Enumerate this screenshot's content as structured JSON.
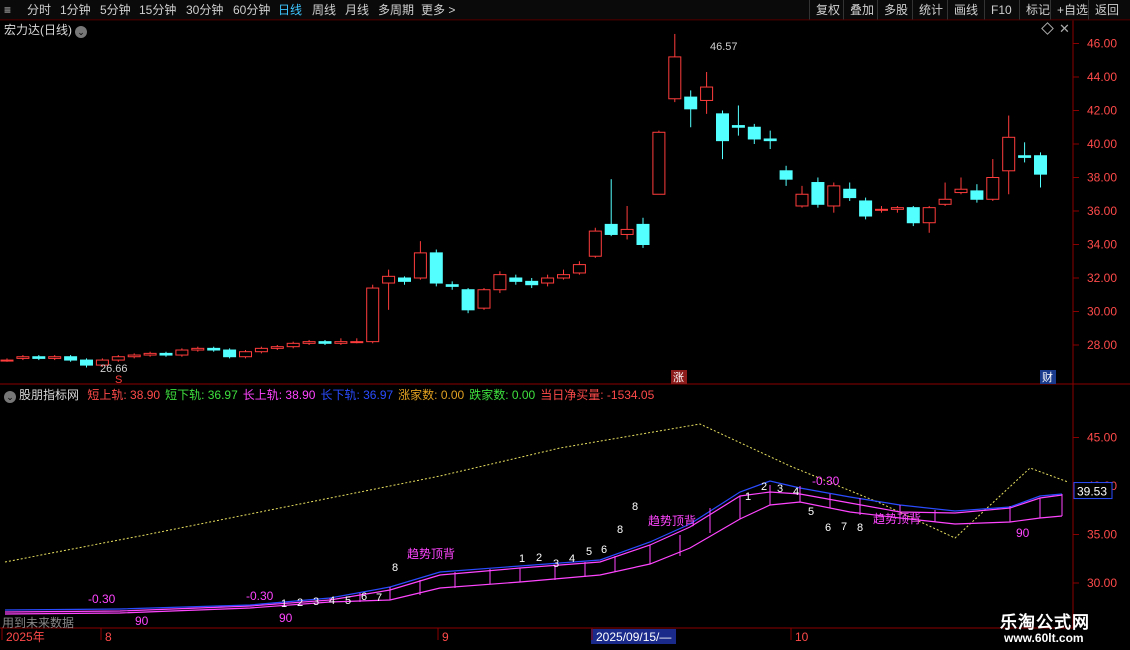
{
  "toolbar": {
    "periods": [
      "分时",
      "1分钟",
      "5分钟",
      "15分钟",
      "30分钟",
      "60分钟",
      "日线",
      "周线",
      "月线",
      "多周期",
      "更多 >"
    ],
    "active": "日线",
    "right": [
      "复权",
      "叠加",
      "多股",
      "统计",
      "画线",
      "F10",
      "标记",
      "+自选",
      "返回"
    ]
  },
  "main": {
    "title": "宏力达(日线)",
    "high_label": "46.57",
    "low_label": "26.66",
    "marker_zhang": "涨",
    "marker_cai": "财",
    "marker_s": "S"
  },
  "indicator": {
    "name": "股朋指标网",
    "fields": [
      {
        "label": "短上轨:",
        "value": "38.90",
        "color": "#ff4a4a"
      },
      {
        "label": "短下轨:",
        "value": "36.97",
        "color": "#3ee03e"
      },
      {
        "label": "长上轨:",
        "value": "38.90",
        "color": "#ff45ff"
      },
      {
        "label": "长下轨:",
        "value": "36.97",
        "color": "#2a4cff"
      },
      {
        "label": "涨家数:",
        "value": "0.00",
        "color": "#e0a020"
      },
      {
        "label": "跌家数:",
        "value": "0.00",
        "color": "#3ee03e"
      },
      {
        "label": "当日净买量:",
        "value": "-1534.05",
        "color": "#ff4a4a"
      }
    ],
    "current_value": "39.53",
    "annotations": {
      "divergence": "趋势顶背",
      "neg": "-0.30",
      "ninety": "90",
      "seq_a": [
        "1",
        "2",
        "3",
        "4",
        "5",
        "6",
        "7"
      ],
      "seq_b": [
        "1",
        "2",
        "3",
        "4",
        "5",
        "6",
        "8"
      ],
      "seq_c": [
        "1",
        "2",
        "3",
        "4"
      ],
      "seq_d": [
        "5",
        "6",
        "7",
        "8"
      ],
      "eight": "8"
    }
  },
  "axis": {
    "price_ticks": [
      "46.00",
      "44.00",
      "42.00",
      "40.00",
      "38.00",
      "36.00",
      "34.00",
      "32.00",
      "30.00",
      "28.00"
    ],
    "ind_ticks": [
      "45.00",
      "40.00",
      "35.00",
      "30.00"
    ],
    "dates": [
      "2025年",
      "8",
      "9",
      "2025/09/15/—",
      "10"
    ]
  },
  "footer": {
    "watermark": "用到未来数据",
    "logo": "乐淘公式网",
    "url": "www.60lt.com"
  },
  "colors": {
    "up": "#ff3c3c",
    "down": "#54ffff",
    "axis": "#8b0000"
  },
  "chart_data": {
    "type": "candlestick",
    "candles": [
      [
        27.1,
        27.1,
        27.2,
        27.0
      ],
      [
        27.2,
        27.3,
        27.4,
        27.1
      ],
      [
        27.3,
        27.2,
        27.4,
        27.1
      ],
      [
        27.2,
        27.3,
        27.4,
        27.1
      ],
      [
        27.3,
        27.1,
        27.4,
        27.0
      ],
      [
        27.1,
        26.8,
        27.2,
        26.66
      ],
      [
        26.8,
        27.1,
        27.2,
        26.7
      ],
      [
        27.1,
        27.3,
        27.4,
        27.0
      ],
      [
        27.3,
        27.4,
        27.5,
        27.2
      ],
      [
        27.4,
        27.5,
        27.6,
        27.3
      ],
      [
        27.5,
        27.4,
        27.6,
        27.3
      ],
      [
        27.4,
        27.7,
        27.8,
        27.3
      ],
      [
        27.7,
        27.8,
        27.9,
        27.6
      ],
      [
        27.8,
        27.7,
        27.9,
        27.6
      ],
      [
        27.7,
        27.3,
        27.8,
        27.2
      ],
      [
        27.3,
        27.6,
        27.7,
        27.2
      ],
      [
        27.6,
        27.8,
        27.9,
        27.5
      ],
      [
        27.8,
        27.9,
        28.0,
        27.7
      ],
      [
        27.9,
        28.1,
        28.2,
        27.8
      ],
      [
        28.1,
        28.2,
        28.3,
        28.0
      ],
      [
        28.2,
        28.1,
        28.3,
        28.0
      ],
      [
        28.1,
        28.2,
        28.4,
        28.0
      ],
      [
        28.2,
        28.2,
        28.4,
        28.1
      ],
      [
        28.2,
        31.4,
        31.6,
        28.1
      ],
      [
        31.7,
        32.1,
        32.5,
        30.1
      ],
      [
        32.0,
        31.8,
        32.1,
        31.6
      ],
      [
        32.0,
        33.5,
        34.2,
        31.9
      ],
      [
        33.5,
        31.7,
        33.7,
        31.5
      ],
      [
        31.6,
        31.5,
        31.8,
        31.3
      ],
      [
        31.3,
        30.1,
        31.4,
        29.9
      ],
      [
        30.2,
        31.3,
        31.4,
        30.1
      ],
      [
        31.3,
        32.2,
        32.4,
        31.1
      ],
      [
        32.0,
        31.8,
        32.2,
        31.6
      ],
      [
        31.8,
        31.6,
        32.0,
        31.4
      ],
      [
        31.7,
        32.0,
        32.2,
        31.5
      ],
      [
        32.0,
        32.2,
        32.5,
        31.9
      ],
      [
        32.3,
        32.8,
        33.0,
        32.2
      ],
      [
        33.3,
        34.8,
        35.0,
        33.2
      ],
      [
        35.2,
        34.6,
        37.9,
        34.5
      ],
      [
        34.6,
        34.9,
        36.3,
        34.3
      ],
      [
        35.2,
        34.0,
        35.6,
        33.8
      ],
      [
        37.0,
        40.7,
        40.8,
        37.0
      ],
      [
        42.7,
        45.2,
        46.57,
        42.5
      ],
      [
        42.8,
        42.1,
        43.2,
        41.0
      ],
      [
        42.6,
        43.4,
        44.3,
        41.8
      ],
      [
        41.8,
        40.2,
        42.0,
        39.1
      ],
      [
        41.1,
        41.0,
        42.3,
        40.5
      ],
      [
        41.0,
        40.3,
        41.2,
        40.0
      ],
      [
        40.3,
        40.2,
        40.8,
        39.7
      ],
      [
        38.4,
        37.9,
        38.7,
        37.5
      ],
      [
        36.3,
        37.0,
        37.5,
        36.2
      ],
      [
        37.7,
        36.4,
        38.0,
        36.2
      ],
      [
        36.3,
        37.5,
        37.7,
        35.9
      ],
      [
        37.3,
        36.8,
        37.7,
        36.6
      ],
      [
        36.6,
        35.7,
        36.8,
        35.5
      ],
      [
        36.1,
        36.1,
        36.3,
        35.9
      ],
      [
        36.1,
        36.2,
        36.3,
        35.9
      ],
      [
        36.2,
        35.3,
        36.3,
        35.1
      ],
      [
        35.3,
        36.2,
        36.3,
        34.7
      ],
      [
        36.4,
        36.7,
        37.7,
        36.3
      ],
      [
        37.1,
        37.3,
        38.0,
        37.0
      ],
      [
        37.2,
        36.7,
        37.6,
        36.5
      ],
      [
        36.7,
        38.0,
        39.1,
        36.6
      ],
      [
        38.4,
        40.4,
        41.7,
        37.0
      ],
      [
        39.3,
        39.2,
        40.1,
        38.9
      ],
      [
        39.3,
        38.2,
        39.5,
        37.4
      ]
    ]
  }
}
